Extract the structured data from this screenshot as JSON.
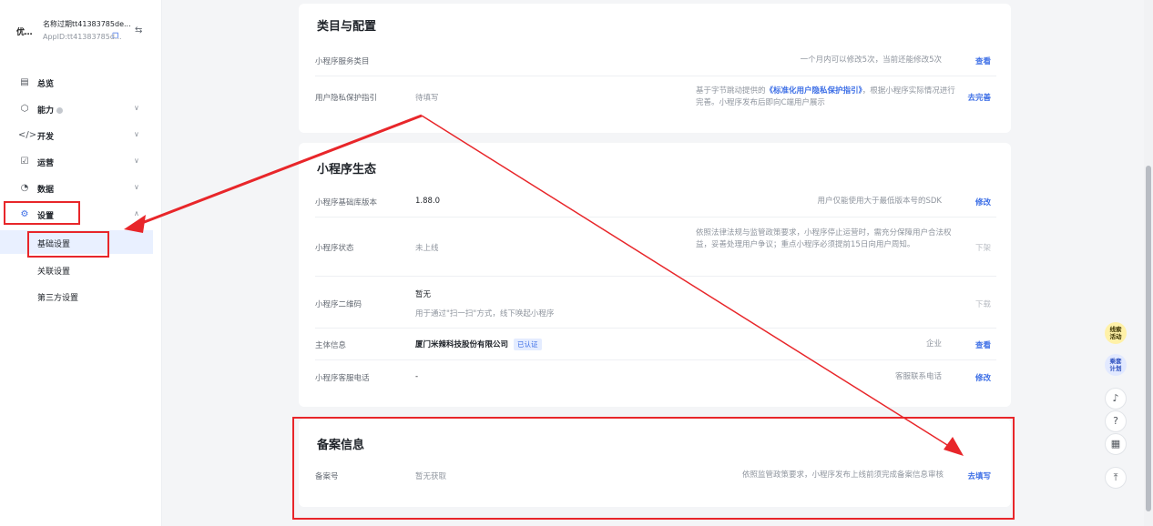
{
  "app": {
    "logo_text": "优...",
    "name": "名称过期tt41383785de...",
    "app_id": "AppID:tt41383785d...",
    "copy_icon": "copy-icon",
    "switch_icon": "switch-icon"
  },
  "sidebar": {
    "items": [
      {
        "label": "总览",
        "icon": "overview-icon"
      },
      {
        "label": "能力",
        "icon": "ability-icon"
      },
      {
        "label": "开发",
        "icon": "code-icon"
      },
      {
        "label": "运营",
        "icon": "chart-icon"
      },
      {
        "label": "数据",
        "icon": "pie-icon"
      },
      {
        "label": "设置",
        "icon": "settings-icon"
      }
    ],
    "sub_items": [
      "基础设置",
      "关联设置",
      "第三方设置"
    ]
  },
  "category_card": {
    "title": "类目与配置",
    "rows": [
      {
        "label": "小程序服务类目",
        "value": "",
        "desc": "一个月内可以修改5次，当前还能修改5次",
        "action": "查看"
      },
      {
        "label": "用户隐私保护指引",
        "value": "待填写",
        "desc_pre": "基于字节跳动提供的",
        "desc_link": "《标准化用户隐私保护指引》",
        "desc_post": "，根据小程序实际情况进行完善。小程序发布后即向C端用户展示",
        "action": "去完善"
      }
    ]
  },
  "ecosystem_card": {
    "title": "小程序生态",
    "rows": [
      {
        "label": "小程序基础库版本",
        "value": "1.88.0",
        "desc": "用户仅能使用大于最低版本号的SDK",
        "action": "修改"
      },
      {
        "label": "小程序状态",
        "value": "未上线",
        "desc": "依照法律法规与监管政策要求，小程序停止运营时，需充分保障用户合法权益，妥善处理用户争议；重点小程序必须提前15日向用户周知。",
        "action": "下架"
      },
      {
        "label": "小程序二维码",
        "value": "暂无",
        "sub_value": "用于通过\"扫一扫\"方式，线下唤起小程序",
        "action": "下载"
      },
      {
        "label": "主体信息",
        "value": "厦门米辣科技股份有限公司",
        "badge": "已认证",
        "desc": "企业",
        "action": "查看"
      },
      {
        "label": "小程序客服电话",
        "value": "-",
        "desc": "客服联系电话",
        "action": "修改"
      }
    ]
  },
  "filing_card": {
    "title": "备案信息",
    "rows": [
      {
        "label": "备案号",
        "value": "暂无获取",
        "desc": "依照监管政策要求，小程序发布上线前须完成备案信息审核",
        "action": "去填写"
      }
    ]
  },
  "floating": {
    "items": [
      {
        "label": "线索活动"
      },
      {
        "label": "乘套计划"
      }
    ],
    "icons": [
      "headset-icon",
      "help-icon",
      "qrcode-icon",
      "back-to-top-icon"
    ]
  },
  "annotation_color": "#e8262a",
  "accent_color": "#3c6ee6"
}
